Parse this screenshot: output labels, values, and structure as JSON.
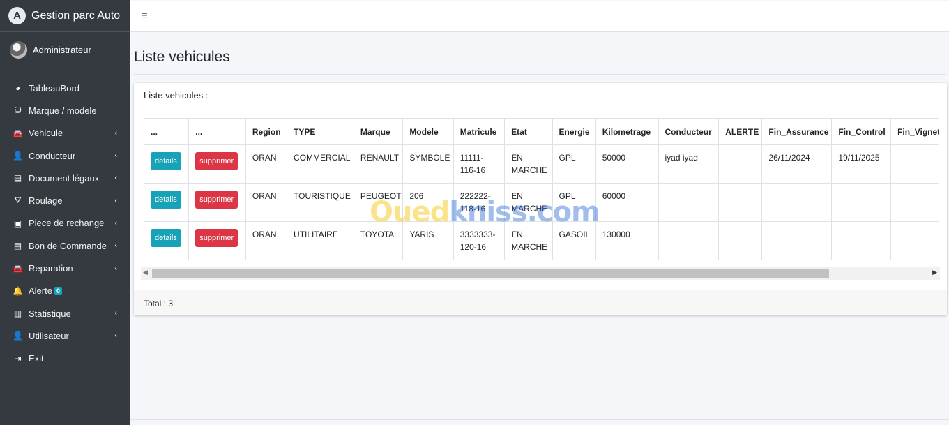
{
  "app": {
    "title": "Gestion parc Auto",
    "logo_letter": "A"
  },
  "user": {
    "name": "Administrateur"
  },
  "sidebar": {
    "items": [
      {
        "label": "TableauBord",
        "icon": "tachometer-icon",
        "glyph": "◕",
        "chevron": false
      },
      {
        "label": "Marque / modele",
        "icon": "database-icon",
        "glyph": "⛁",
        "chevron": false
      },
      {
        "label": "Vehicule",
        "icon": "car-icon",
        "glyph": "🚘",
        "chevron": true
      },
      {
        "label": "Conducteur",
        "icon": "user-icon",
        "glyph": "👤",
        "chevron": true
      },
      {
        "label": "Document légaux",
        "icon": "file-icon",
        "glyph": "▤",
        "chevron": true
      },
      {
        "label": "Roulage",
        "icon": "road-icon",
        "glyph": "⛛",
        "chevron": true
      },
      {
        "label": "Piece de rechange",
        "icon": "toolbox-icon",
        "glyph": "▣",
        "chevron": true
      },
      {
        "label": "Bon de Commande",
        "icon": "file-icon",
        "glyph": "▤",
        "chevron": true
      },
      {
        "label": "Reparation",
        "icon": "car-icon",
        "glyph": "🚘",
        "chevron": true
      },
      {
        "label": "Alerte",
        "icon": "bell-icon",
        "glyph": "🔔",
        "chevron": false,
        "badge": "0"
      },
      {
        "label": "Statistique",
        "icon": "chart-icon",
        "glyph": "▥",
        "chevron": true
      },
      {
        "label": "Utilisateur",
        "icon": "user-icon",
        "glyph": "👤",
        "chevron": true
      },
      {
        "label": "Exit",
        "icon": "sign-out-icon",
        "glyph": "⇥",
        "chevron": false
      }
    ]
  },
  "page": {
    "title": "Liste vehicules"
  },
  "card": {
    "header": "Liste vehicules :",
    "footer": "Total : 3"
  },
  "table": {
    "columns": [
      "...",
      "...",
      "Region",
      "TYPE",
      "Marque",
      "Modele",
      "Matricule",
      "Etat",
      "Energie",
      "Kilometrage",
      "Conducteur",
      "ALERTE",
      "Fin_Assurance",
      "Fin_Control",
      "Fin_Vignette"
    ],
    "details_label": "details",
    "delete_label": "supprimer",
    "rows": [
      {
        "region": "ORAN",
        "type": "COMMERCIAL",
        "marque": "RENAULT",
        "modele": "SYMBOLE",
        "matricule": "11111-116-16",
        "etat": "EN MARCHE",
        "energie": "GPL",
        "km": "50000",
        "conducteur": "iyad iyad",
        "alerte": "",
        "fin_assurance": "26/11/2024",
        "fin_control": "19/11/2025",
        "fin_vignette": ""
      },
      {
        "region": "ORAN",
        "type": "TOURISTIQUE",
        "marque": "PEUGEOT",
        "modele": "206",
        "matricule": "222222-118-16",
        "etat": "EN MARCHE",
        "energie": "GPL",
        "km": "60000",
        "conducteur": "",
        "alerte": "",
        "fin_assurance": "",
        "fin_control": "",
        "fin_vignette": ""
      },
      {
        "region": "ORAN",
        "type": "UTILITAIRE",
        "marque": "TOYOTA",
        "modele": "YARIS",
        "matricule": "3333333-120-16",
        "etat": "EN MARCHE",
        "energie": "GASOIL",
        "km": "130000",
        "conducteur": "",
        "alerte": "",
        "fin_assurance": "",
        "fin_control": "",
        "fin_vignette": ""
      }
    ]
  },
  "watermark": {
    "part1": "Oued",
    "part2": "kniss.com"
  },
  "colors": {
    "sidebar": "#343a40",
    "info": "#17a2b8",
    "danger": "#dc3545"
  }
}
